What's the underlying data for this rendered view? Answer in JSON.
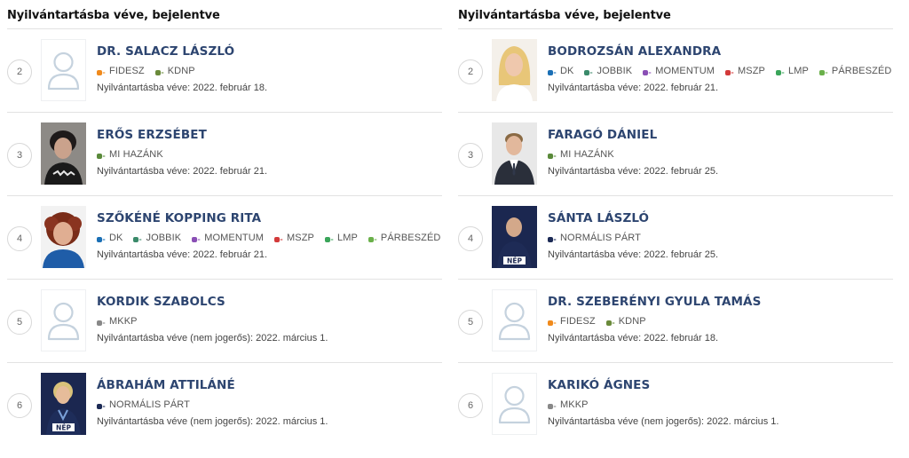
{
  "left": {
    "title": "Nyilvántartásba véve, bejelentve",
    "candidates": [
      {
        "num": "2",
        "name": "DR. SALACZ LÁSZLÓ",
        "photo": "placeholder",
        "parties": [
          {
            "label": "FIDESZ",
            "color": "#f08a1c"
          },
          {
            "label": "KDNP",
            "color": "#6a8a3a"
          }
        ],
        "status": "Nyilvántartásba véve: 2022. február 18."
      },
      {
        "num": "3",
        "name": "ERŐS ERZSÉBET",
        "photo": "woman-dark-hair",
        "parties": [
          {
            "label": "MI HAZÁNK",
            "color": "#5a8a3a"
          }
        ],
        "status": "Nyilvántartásba véve: 2022. február 21."
      },
      {
        "num": "4",
        "name": "SZŐKÉNÉ KOPPING RITA",
        "photo": "woman-red-curly",
        "parties": [
          {
            "label": "DK",
            "color": "#1a6fb5"
          },
          {
            "label": "JOBBIK",
            "color": "#3a8a6a"
          },
          {
            "label": "MOMENTUM",
            "color": "#8a4fb5"
          },
          {
            "label": "MSZP",
            "color": "#d33a3a"
          },
          {
            "label": "LMP",
            "color": "#3aa55a"
          },
          {
            "label": "PÁRBESZÉD",
            "color": "#6ab04a"
          }
        ],
        "status": "Nyilvántartásba véve: 2022. február 21."
      },
      {
        "num": "5",
        "name": "KORDIK SZABOLCS",
        "photo": "placeholder",
        "parties": [
          {
            "label": "MKKP",
            "color": "#888888"
          }
        ],
        "status": "Nyilvántartásba véve (nem jogerős): 2022. március 1."
      },
      {
        "num": "6",
        "name": "ÁBRAHÁM ATTILÁNÉ",
        "photo": "nep-woman",
        "parties": [
          {
            "label": "NORMÁLIS PÁRT",
            "color": "#1c2a55"
          }
        ],
        "status": "Nyilvántartásba véve (nem jogerős): 2022. március 1."
      }
    ]
  },
  "right": {
    "title": "Nyilvántartásba véve, bejelentve",
    "candidates": [
      {
        "num": "2",
        "name": "BODROZSÁN ALEXANDRA",
        "photo": "woman-blonde",
        "parties": [
          {
            "label": "DK",
            "color": "#1a6fb5"
          },
          {
            "label": "JOBBIK",
            "color": "#3a8a6a"
          },
          {
            "label": "MOMENTUM",
            "color": "#8a4fb5"
          },
          {
            "label": "MSZP",
            "color": "#d33a3a"
          },
          {
            "label": "LMP",
            "color": "#3aa55a"
          },
          {
            "label": "PÁRBESZÉD",
            "color": "#6ab04a"
          }
        ],
        "status": "Nyilvántartásba véve: 2022. február 21."
      },
      {
        "num": "3",
        "name": "FARAGÓ DÁNIEL",
        "photo": "man-suit",
        "parties": [
          {
            "label": "MI HAZÁNK",
            "color": "#5a8a3a"
          }
        ],
        "status": "Nyilvántartásba véve: 2022. február 25."
      },
      {
        "num": "4",
        "name": "SÁNTA LÁSZLÓ",
        "photo": "nep-man",
        "parties": [
          {
            "label": "NORMÁLIS PÁRT",
            "color": "#1c2a55"
          }
        ],
        "status": "Nyilvántartásba véve: 2022. február 25."
      },
      {
        "num": "5",
        "name": "DR. SZEBERÉNYI GYULA TAMÁS",
        "photo": "placeholder",
        "parties": [
          {
            "label": "FIDESZ",
            "color": "#f08a1c"
          },
          {
            "label": "KDNP",
            "color": "#6a8a3a"
          }
        ],
        "status": "Nyilvántartásba véve: 2022. február 18."
      },
      {
        "num": "6",
        "name": "KARIKÓ ÁGNES",
        "photo": "placeholder",
        "parties": [
          {
            "label": "MKKP",
            "color": "#888888"
          }
        ],
        "status": "Nyilvántartásba véve (nem jogerős): 2022. március 1."
      }
    ]
  }
}
